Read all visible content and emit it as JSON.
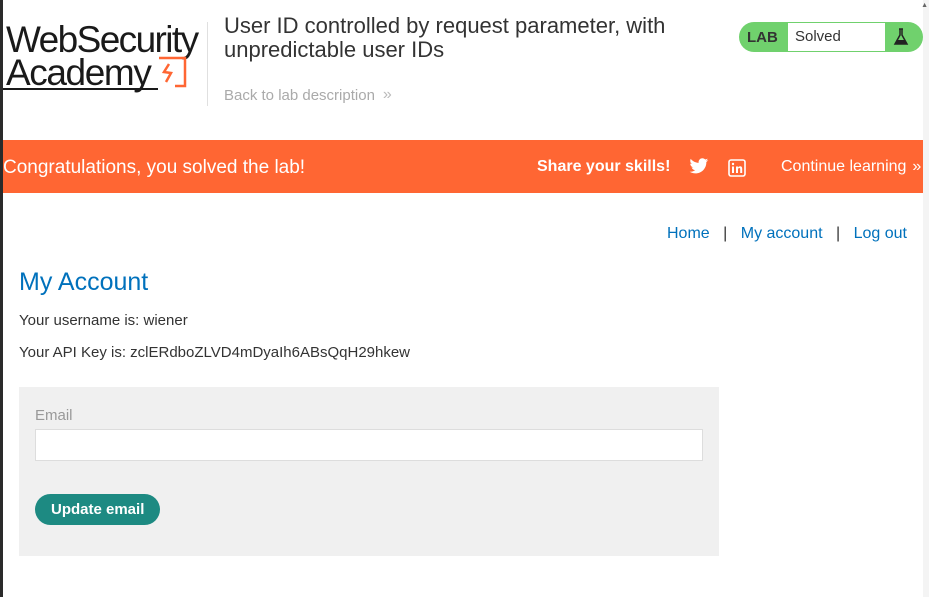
{
  "header": {
    "logo": {
      "line1": "WebSecurity",
      "line2": "Academy"
    },
    "lab_title": "User ID controlled by request parameter, with unpredictable user IDs",
    "back_link": "Back to lab description",
    "lab_status": {
      "label": "LAB",
      "value": "Solved",
      "icon": "flask-icon",
      "color": "#70d16d"
    }
  },
  "banner": {
    "message": "Congratulations, you solved the lab!",
    "share_label": "Share your skills!",
    "social_icons": [
      "twitter-icon",
      "linkedin-icon"
    ],
    "continue_link": "Continue learning",
    "color": "#ff6633"
  },
  "nav": {
    "home": "Home",
    "separator": "|",
    "account": "My account",
    "logout": "Log out"
  },
  "account": {
    "title": "My Account",
    "username_line": "Your username is: wiener",
    "apikey_line": "Your API Key is: zclERdboZLVD4mDyaIh6ABsQqH29hkew"
  },
  "form": {
    "email_label": "Email",
    "email_value": "",
    "submit_label": "Update email",
    "button_color": "#1d8a82"
  }
}
